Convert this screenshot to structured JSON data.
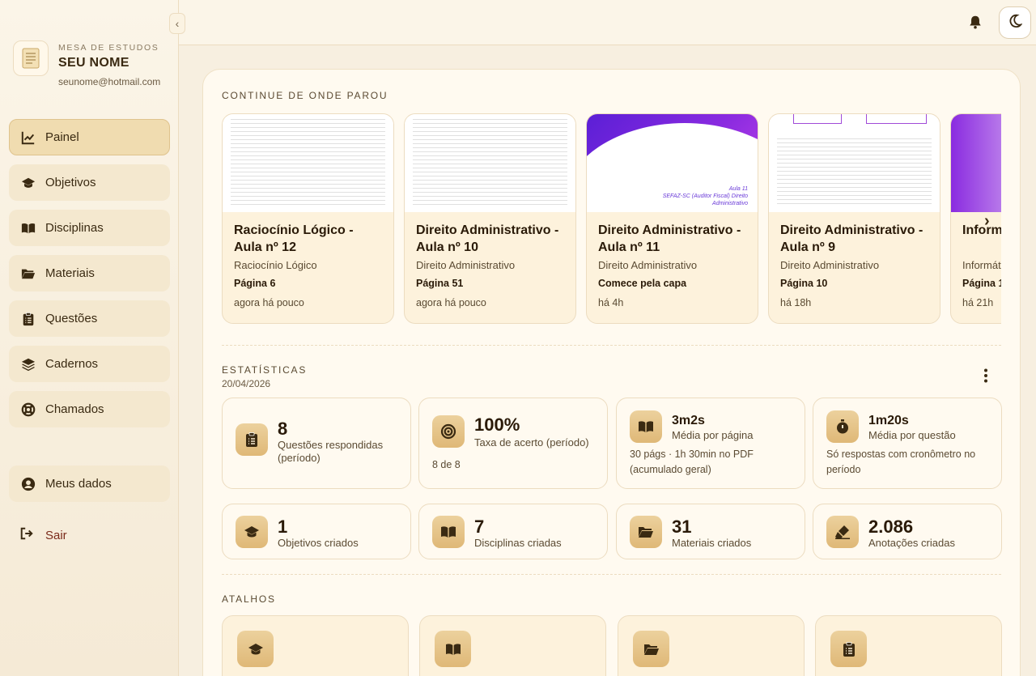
{
  "sidebar": {
    "brand": {
      "small": "MESA DE ESTUDOS",
      "name": "SEU NOME",
      "email": "seunome@hotmail.com"
    },
    "items": [
      {
        "label": "Painel",
        "icon": "chart-line-icon",
        "active": true
      },
      {
        "label": "Objetivos",
        "icon": "graduation-cap-icon"
      },
      {
        "label": "Disciplinas",
        "icon": "book-open-icon"
      },
      {
        "label": "Materiais",
        "icon": "folder-open-icon"
      },
      {
        "label": "Questões",
        "icon": "clipboard-list-icon"
      },
      {
        "label": "Cadernos",
        "icon": "layers-icon"
      },
      {
        "label": "Chamados",
        "icon": "lifebuoy-icon"
      }
    ],
    "user_item": {
      "label": "Meus dados",
      "icon": "user-circle-icon"
    },
    "logout": {
      "label": "Sair",
      "icon": "sign-out-icon"
    }
  },
  "topbar": {
    "bell_icon": "bell-icon",
    "theme_icon": "moon-icon"
  },
  "continue": {
    "title": "CONTINUE DE ONDE PAROU",
    "cards": [
      {
        "title": "Raciocínio Lógico - Aula nº 12",
        "subject": "Raciocínio Lógico",
        "page": "Página 6",
        "time": "agora há pouco",
        "thumb": "doc"
      },
      {
        "title": "Direito Administrativo - Aula nº 10",
        "subject": "Direito Administrativo",
        "page": "Página 51",
        "time": "agora há pouco",
        "thumb": "doc"
      },
      {
        "title": "Direito Administrativo - Aula nº 11",
        "subject": "Direito Administrativo",
        "page": "Comece pela capa",
        "time": "há 4h",
        "thumb": "cover",
        "cover_text": "Aula 11\nSEFAZ-SC (Auditor Fiscal) Direito\nAdministrativo"
      },
      {
        "title": "Direito Administrativo - Aula nº 9",
        "subject": "Direito Administrativo",
        "page": "Página 10",
        "time": "há 18h",
        "thumb": "doc"
      },
      {
        "title": "Inform",
        "subject": "Informát",
        "page": "Página 1",
        "time": "há 21h",
        "thumb": "cover",
        "cover_text": ""
      }
    ]
  },
  "stats": {
    "title": "ESTATÍSTICAS",
    "date": "20/04/2026",
    "row1": [
      {
        "value": "8",
        "label": "Questões respondidas (período)",
        "note": "",
        "icon": "clipboard-list-icon"
      },
      {
        "value": "100%",
        "label": "Taxa de acerto (período)",
        "note": "8 de 8",
        "icon": "target-icon"
      },
      {
        "value": "3m2s",
        "label": "Média por página",
        "note": "30 págs · 1h 30min no PDF (acumulado geral)",
        "icon": "book-open-icon"
      },
      {
        "value": "1m20s",
        "label": "Média por questão",
        "note": "Só respostas com cronômetro no período",
        "icon": "stopwatch-icon"
      }
    ],
    "row2": [
      {
        "value": "1",
        "label": "Objetivos criados",
        "icon": "graduation-cap-icon"
      },
      {
        "value": "7",
        "label": "Disciplinas criadas",
        "icon": "book-open-icon"
      },
      {
        "value": "31",
        "label": "Materiais criados",
        "icon": "folder-open-icon"
      },
      {
        "value": "2.086",
        "label": "Anotações criadas",
        "icon": "highlighter-icon"
      }
    ]
  },
  "shortcuts": {
    "title": "ATALHOS",
    "items": [
      {
        "icon": "graduation-cap-icon"
      },
      {
        "icon": "book-open-icon"
      },
      {
        "icon": "folder-open-icon"
      },
      {
        "icon": "clipboard-list-icon"
      }
    ]
  },
  "colors": {
    "accent": "#dfb877",
    "text": "#3a2a12",
    "bg": "#f7efe0"
  }
}
